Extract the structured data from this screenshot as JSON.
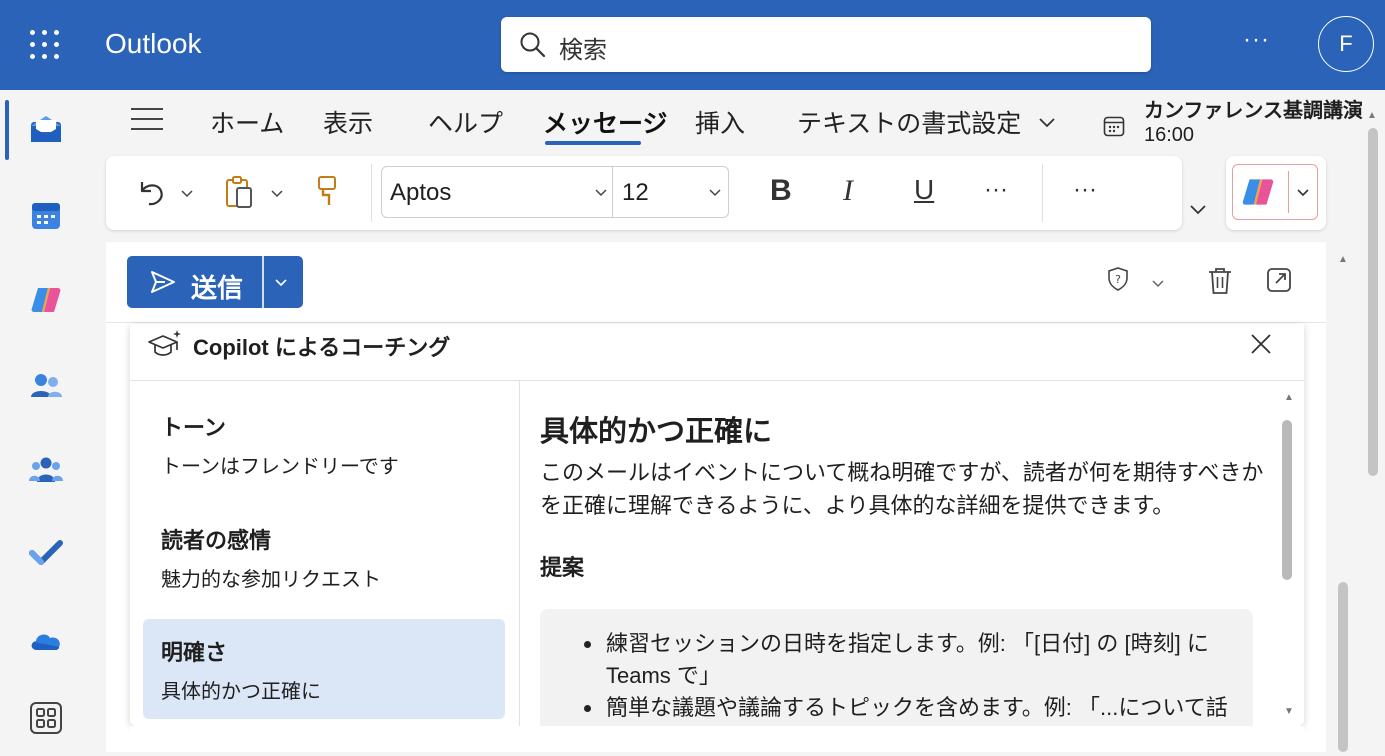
{
  "topbar": {
    "app_name": "Outlook",
    "search_placeholder": "検索",
    "more_label": "···",
    "avatar_initial": "F"
  },
  "rail": {
    "items": [
      "mail-icon",
      "calendar-icon",
      "copilot-icon",
      "people-icon",
      "groups-icon",
      "todo-icon",
      "onedrive-icon",
      "apps-icon"
    ]
  },
  "tabs": {
    "items": [
      {
        "label": "ホーム"
      },
      {
        "label": "表示"
      },
      {
        "label": "ヘルプ"
      },
      {
        "label": "メッセージ"
      },
      {
        "label": "挿入"
      },
      {
        "label": "テキストの書式設定"
      }
    ],
    "active": "メッセージ"
  },
  "event": {
    "title": "カンファレンス基調講演",
    "time": "16:00"
  },
  "ribbon": {
    "font_name": "Aptos",
    "font_size": "12",
    "bold_label": "B",
    "italic_label": "I",
    "underline_label": "U",
    "more1": "···",
    "more2": "···"
  },
  "compose": {
    "send_label": "送信"
  },
  "coaching": {
    "title": "Copilot によるコーチング",
    "categories": [
      {
        "title": "トーン",
        "sub": "トーンはフレンドリーです"
      },
      {
        "title": "読者の感情",
        "sub": "魅力的な参加リクエスト"
      },
      {
        "title": "明確さ",
        "sub": "具体的かつ正確に"
      }
    ],
    "active_index": 2,
    "detail": {
      "title": "具体的かつ正確に",
      "body": "このメールはイベントについて概ね明確ですが、読者が何を期待すべきかを正確に理解できるように、より具体的な詳細を提供できます。",
      "suggestions_heading": "提案",
      "suggestions": [
        "練習セッションの日時を指定します。例: 「[日付] の [時刻] に Teams で」",
        "簡単な議題や議論するトピックを含めます。例: 「...について話し合います」"
      ]
    }
  },
  "colors": {
    "brand": "#2b63b9",
    "active_category": "#dbe6f7"
  }
}
